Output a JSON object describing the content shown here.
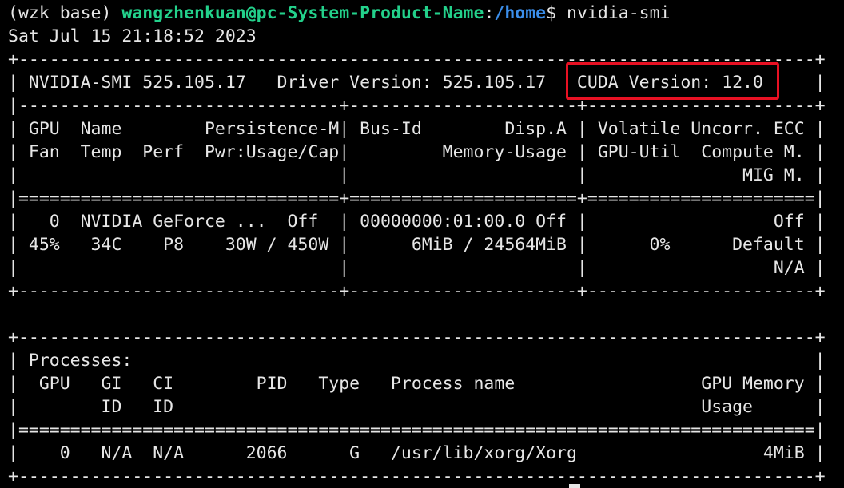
{
  "prompt": {
    "env": "(wzk_base)",
    "user_host": "wangzhenkuan@pc-System-Product-Name",
    "separator": ":",
    "cwd": "/home",
    "symbol": "$",
    "command": "nvidia-smi"
  },
  "timestamp": "Sat Jul 15 21:18:52 2023",
  "smi_table": [
    "+-----------------------------------------------------------------------------+",
    "| NVIDIA-SMI 525.105.17   Driver Version: 525.105.17   CUDA Version: 12.0     |",
    "|-------------------------------+----------------------+----------------------+",
    "| GPU  Name        Persistence-M| Bus-Id        Disp.A | Volatile Uncorr. ECC |",
    "| Fan  Temp  Perf  Pwr:Usage/Cap|         Memory-Usage | GPU-Util  Compute M. |",
    "|                               |                      |               MIG M. |",
    "|===============================+======================+======================|",
    "|   0  NVIDIA GeForce ...  Off  | 00000000:01:00.0 Off |                  Off |",
    "| 45%   34C    P8    30W / 450W |      6MiB / 24564MiB |      0%      Default |",
    "|                               |                      |                  N/A |",
    "+-------------------------------+----------------------+----------------------+",
    "",
    "+-----------------------------------------------------------------------------+",
    "| Processes:                                                                  |",
    "|  GPU   GI   CI        PID   Type   Process name                  GPU Memory |",
    "|        ID   ID                                                   Usage      |",
    "|=============================================================================|",
    "|    0   N/A  N/A      2066      G   /usr/lib/xorg/Xorg                  4MiB |",
    "+-----------------------------------------------------------------------------+"
  ],
  "colors": {
    "background": "#000000",
    "text": "#e6e6e6",
    "user_host": "#23d18b",
    "path": "#3b8eea",
    "highlight_box": "#e81123"
  }
}
